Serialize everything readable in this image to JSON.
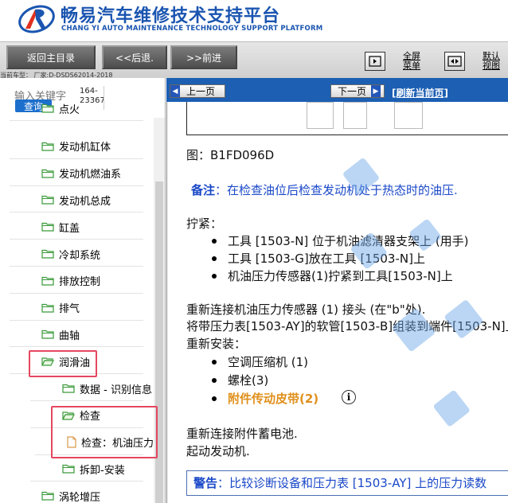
{
  "header": {
    "title_cn": "畅易汽车维修技术支持平台",
    "title_en": "CHANG YI AUTO MAINTENANCE TECHNOLOGY SUPPORT PLATFORM"
  },
  "toolbar": {
    "back_main": "返回主目录",
    "back": "<<后退.",
    "forward": ">>前进",
    "fullscreen_line1": "全屏",
    "fullscreen_line2": "菜单",
    "default_line1": "默认",
    "default_line2": "视图",
    "car_info": "当前车型： 厂家:D-DSDS62014-2018"
  },
  "search": {
    "label": "输入关键字",
    "button": "查询",
    "value_line1": "164-",
    "value_line2": "23367"
  },
  "tree": [
    {
      "label": "点火",
      "level": 1,
      "type": "folder"
    },
    {
      "label": "发动机缸体",
      "level": 1,
      "type": "folder"
    },
    {
      "label": "发动机燃油系",
      "level": 1,
      "type": "folder"
    },
    {
      "label": "发动机总成",
      "level": 1,
      "type": "folder"
    },
    {
      "label": "缸盖",
      "level": 1,
      "type": "folder"
    },
    {
      "label": "冷却系统",
      "level": 1,
      "type": "folder"
    },
    {
      "label": "排放控制",
      "level": 1,
      "type": "folder"
    },
    {
      "label": "排气",
      "level": 1,
      "type": "folder"
    },
    {
      "label": "曲轴",
      "level": 1,
      "type": "folder"
    },
    {
      "label": "润滑油",
      "level": 1,
      "type": "folder-open"
    },
    {
      "label": "数据 - 识别信息",
      "level": 2,
      "type": "folder"
    },
    {
      "label": "检查",
      "level": 2,
      "type": "folder-open"
    },
    {
      "label": "检查：机油压力",
      "level": 3,
      "type": "doc"
    },
    {
      "label": "拆卸-安装",
      "level": 2,
      "type": "folder"
    },
    {
      "label": "涡轮增压",
      "level": 1,
      "type": "folder"
    }
  ],
  "content_bar": {
    "prev": "上一页",
    "next": "下一页",
    "refresh": "[刷新当前页]"
  },
  "content": {
    "figure_caption": "图：B1FD096D",
    "note_label": "备注",
    "note_text": "：在检查油位后检查发动机处于热态时的油压.",
    "tighten_title": "拧紧：",
    "tighten_items": [
      "工具 [1503-N] 位于机油滤清器支架上 (用手)",
      "工具 [1503-G]放在工具 [1503-N]上",
      "机油压力传感器(1)拧紧到工具[1503-N]上"
    ],
    "reconnect_line": "重新连接机油压力传感器 (1) 接头 (在\"b\"处).",
    "hose_line": "将带压力表[1503-AY]的软管[1503-B]组装到端件[1503-N]上",
    "reinstall_title": "重新安装：",
    "reinstall_items": [
      "空调压缩机 (1)",
      "螺栓(3)"
    ],
    "reinstall_link": "附件传动皮带(2)",
    "battery_line": "重新连接附件蓄电池.",
    "start_line": "起动发动机.",
    "warning_label": "警告",
    "warning_text": "：比较诊断设备和压力表 [1503-AY] 上的压力读数"
  },
  "colors": {
    "brand_blue": "#1a55b0",
    "bar_blue": "#1c5fb3",
    "note_blue": "#1a48c8",
    "link_orange": "#e0901c",
    "highlight_red": "#e5475f"
  }
}
